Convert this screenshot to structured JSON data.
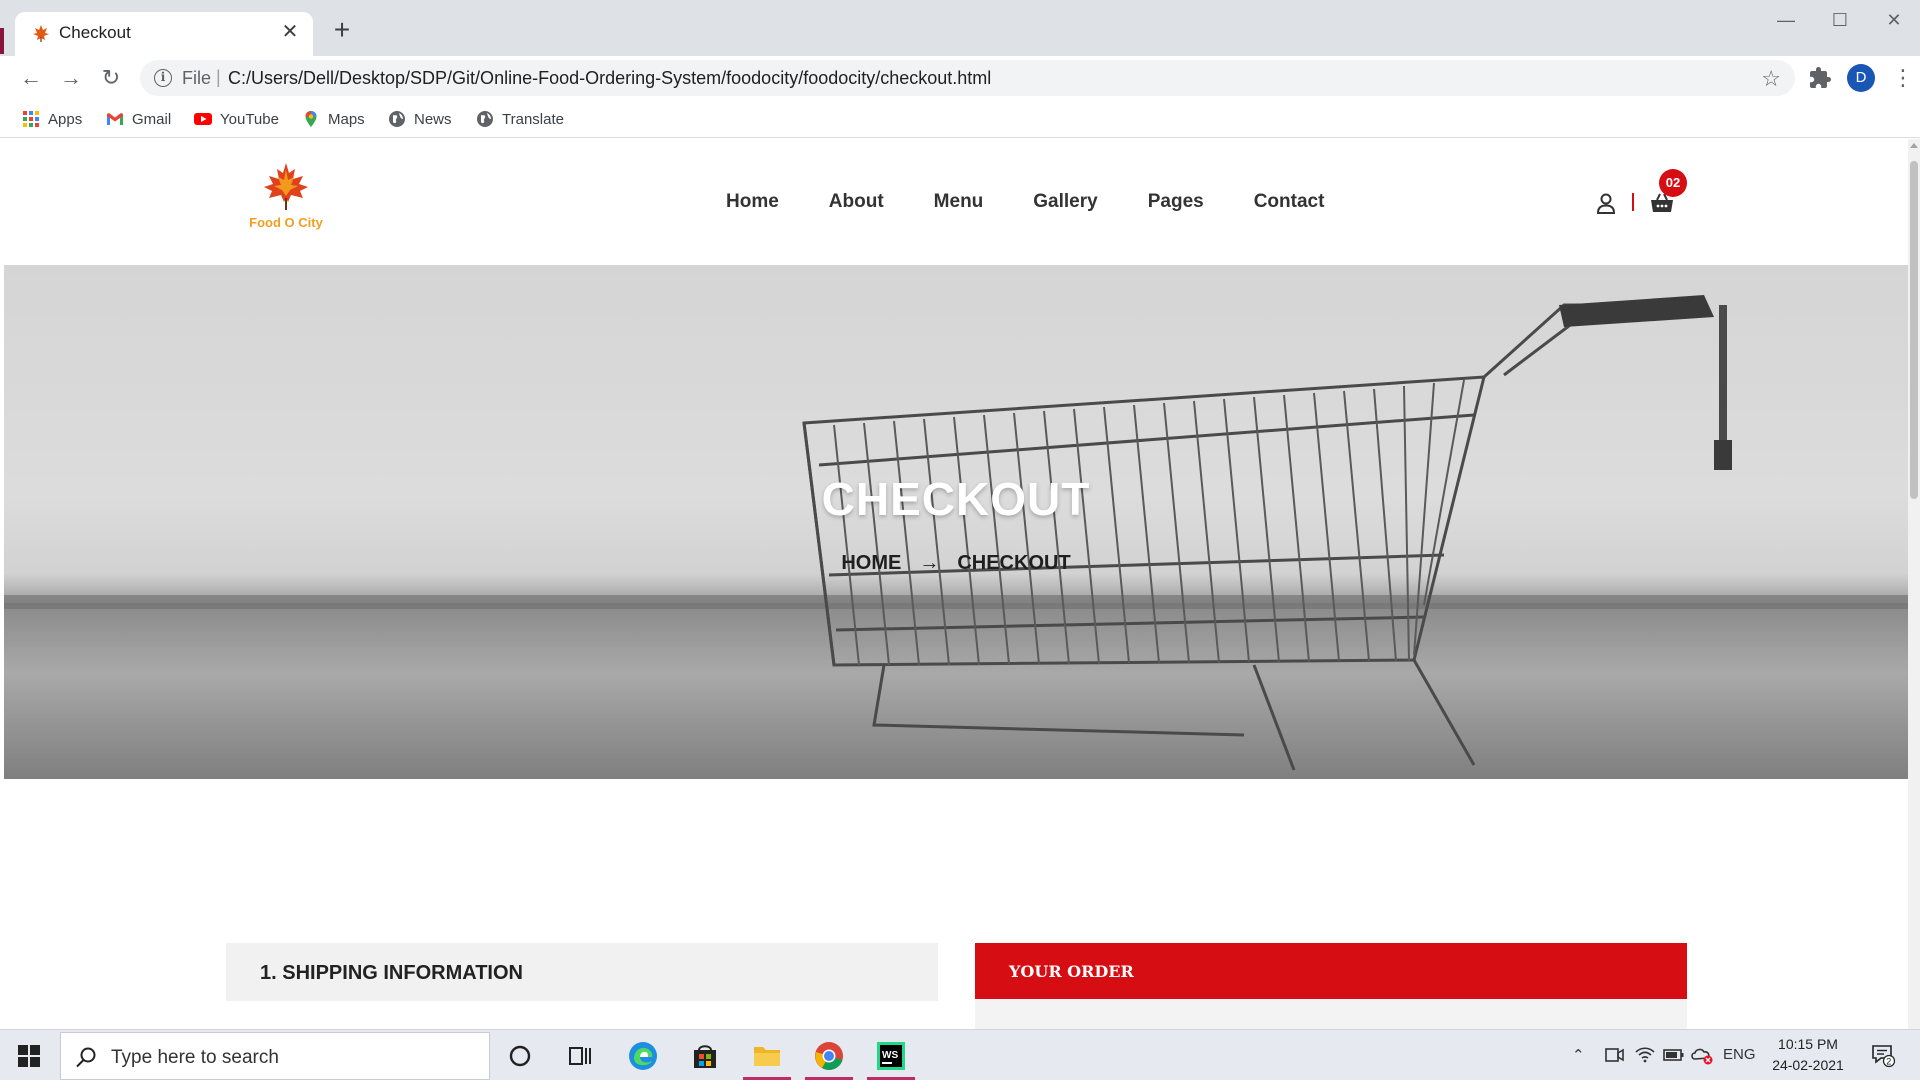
{
  "browser": {
    "tab_title": "Checkout",
    "scheme": "File",
    "url": "C:/Users/Dell/Desktop/SDP/Git/Online-Food-Ordering-System/foodocity/foodocity/checkout.html",
    "profile_initial": "D",
    "bookmarks": [
      {
        "label": "Apps",
        "icon": "apps-grid-icon"
      },
      {
        "label": "Gmail",
        "icon": "gmail-icon"
      },
      {
        "label": "YouTube",
        "icon": "youtube-icon"
      },
      {
        "label": "Maps",
        "icon": "maps-icon"
      },
      {
        "label": "News",
        "icon": "globe-icon"
      },
      {
        "label": "Translate",
        "icon": "globe-icon"
      }
    ]
  },
  "site": {
    "logo_text": "Food O City",
    "nav": [
      "Home",
      "About",
      "Menu",
      "Gallery",
      "Pages",
      "Contact"
    ],
    "cart_count": "02",
    "brand_color": "#d60d13"
  },
  "hero": {
    "title": "CHECKOUT",
    "breadcrumb_home": "HOME",
    "breadcrumb_current": "CHECKOUT"
  },
  "checkout": {
    "shipping_title": "1. SHIPPING INFORMATION",
    "order_title": "YOUR ORDER"
  },
  "taskbar": {
    "search_placeholder": "Type here to search",
    "language": "ENG",
    "time": "10:15 PM",
    "date": "24-02-2021",
    "notification_count": "2"
  }
}
